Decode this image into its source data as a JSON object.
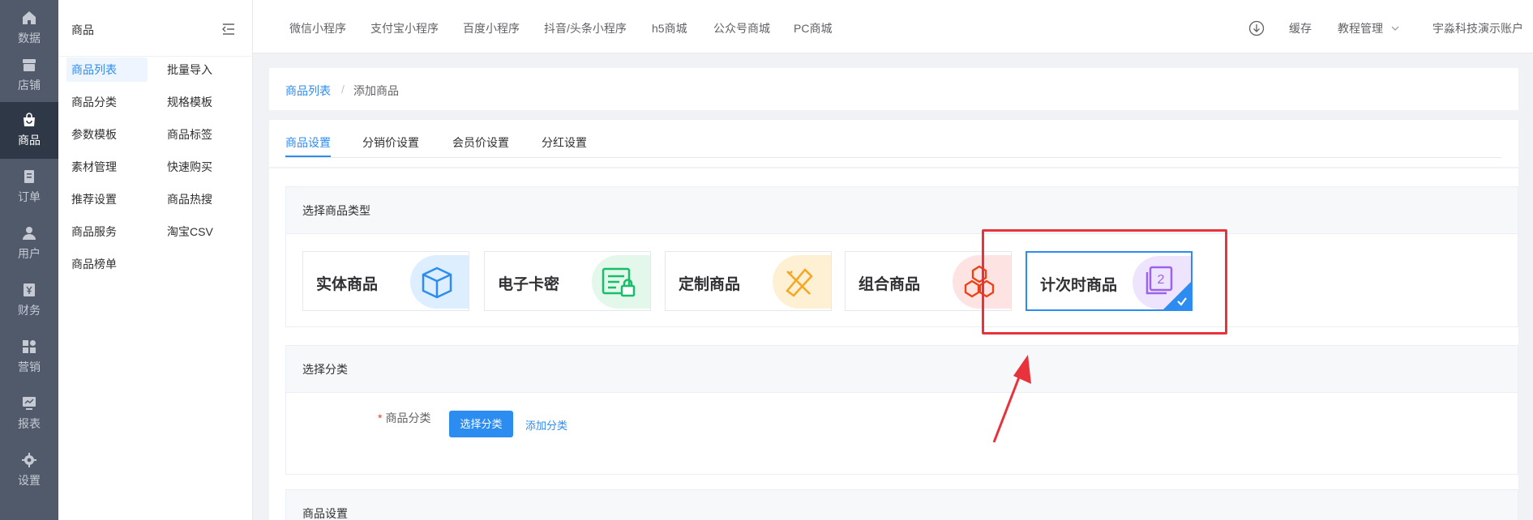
{
  "rail": {
    "items": [
      {
        "label": "数据",
        "icon": "home-icon"
      },
      {
        "label": "店铺",
        "icon": "store-icon"
      },
      {
        "label": "商品",
        "icon": "bag-icon"
      },
      {
        "label": "订单",
        "icon": "document-icon"
      },
      {
        "label": "用户",
        "icon": "user-icon"
      },
      {
        "label": "财务",
        "icon": "yen-icon"
      },
      {
        "label": "营销",
        "icon": "grid-icon"
      },
      {
        "label": "报表",
        "icon": "chart-icon"
      },
      {
        "label": "设置",
        "icon": "gear-icon"
      }
    ],
    "active_index": 2
  },
  "submenu": {
    "title": "商品",
    "items": [
      "商品列表",
      "批量导入",
      "商品分类",
      "规格模板",
      "参数模板",
      "商品标签",
      "素材管理",
      "快速购买",
      "推荐设置",
      "商品热搜",
      "商品服务",
      "淘宝CSV",
      "商品榜单"
    ],
    "active": "商品列表"
  },
  "topbar": {
    "links": [
      "微信小程序",
      "支付宝小程序",
      "百度小程序",
      "抖音/头条小程序",
      "h5商城",
      "公众号商城",
      "PC商城"
    ],
    "cache": "缓存",
    "tutorial": "教程管理",
    "account": "宇淼科技演示账户"
  },
  "breadcrumb": {
    "parent": "商品列表",
    "separator": "/",
    "current": "添加商品"
  },
  "tabs": [
    "商品设置",
    "分销价设置",
    "会员价设置",
    "分红设置"
  ],
  "active_tab": "商品设置",
  "product_type": {
    "heading": "选择商品类型",
    "options": [
      {
        "label": "实体商品",
        "icon": "box-icon",
        "color": "#2d8cf0",
        "bg": "#dceeff"
      },
      {
        "label": "电子卡密",
        "icon": "card-lock-icon",
        "color": "#19be6b",
        "bg": "#e3f7ea"
      },
      {
        "label": "定制商品",
        "icon": "pencil-ruler-icon",
        "color": "#f5a623",
        "bg": "#fdf0d3"
      },
      {
        "label": "组合商品",
        "icon": "hexagons-icon",
        "color": "#ed4014",
        "bg": "#fde3e1"
      },
      {
        "label": "计次时商品",
        "icon": "counter-2-icon",
        "color": "#9a63e8",
        "bg": "#efe4fd"
      }
    ],
    "selected": "计次时商品"
  },
  "category": {
    "heading": "选择分类",
    "field_label": "商品分类",
    "required_mark": "*",
    "select_button": "选择分类",
    "add_link": "添加分类"
  },
  "product_settings": {
    "heading": "商品设置"
  },
  "colors": {
    "accent": "#2d8cf0",
    "rail_bg": "#505a6b",
    "rail_active": "#2f3847",
    "annotation": "#e8323c"
  }
}
